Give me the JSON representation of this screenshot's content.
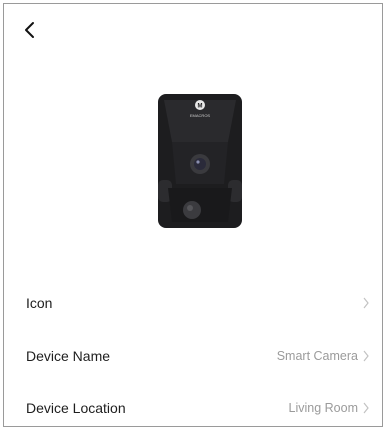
{
  "header": {
    "back_icon": "chevron-left-icon"
  },
  "device_image": {
    "brand_text": "EMACROS"
  },
  "settings": [
    {
      "label": "Icon",
      "value": ""
    },
    {
      "label": "Device Name",
      "value": "Smart Camera"
    },
    {
      "label": "Device Location",
      "value": "Living Room"
    }
  ],
  "colors": {
    "text_primary": "#1e1e1e",
    "text_secondary": "#9b9b9b",
    "camera_body": "#1d1d1f"
  }
}
